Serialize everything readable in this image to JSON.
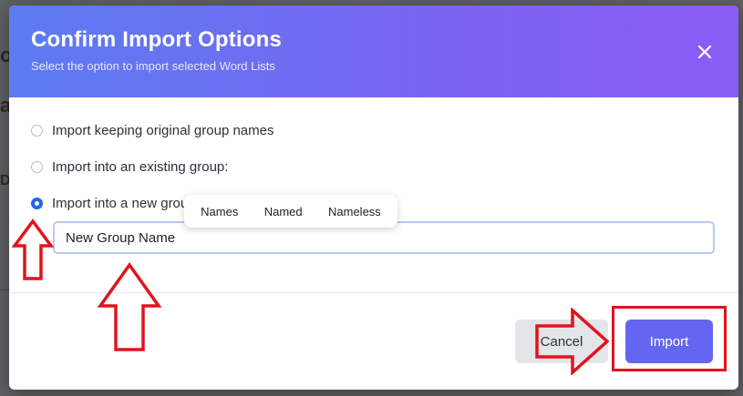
{
  "dialog": {
    "title": "Confirm Import Options",
    "subtitle": "Select the option to import selected Word Lists",
    "close_icon": "close-icon"
  },
  "options": [
    {
      "label": "Import keeping original group names",
      "checked": false
    },
    {
      "label": "Import into an existing group:",
      "checked": false
    },
    {
      "label": "Import into a new group",
      "checked": true
    }
  ],
  "new_group_input": {
    "value": "New Group Name"
  },
  "suggestions": [
    "Names",
    "Named",
    "Nameless"
  ],
  "buttons": {
    "cancel": "Cancel",
    "import": "Import"
  },
  "colors": {
    "header_start": "#5c7cf2",
    "header_end": "#8b5cf6",
    "accent": "#6466f1",
    "radio_checked": "#2563eb",
    "annotation_red": "#e0141e"
  },
  "annotations": [
    "up-arrow-icon",
    "up-arrow-icon",
    "right-arrow-icon",
    "highlight-box"
  ]
}
